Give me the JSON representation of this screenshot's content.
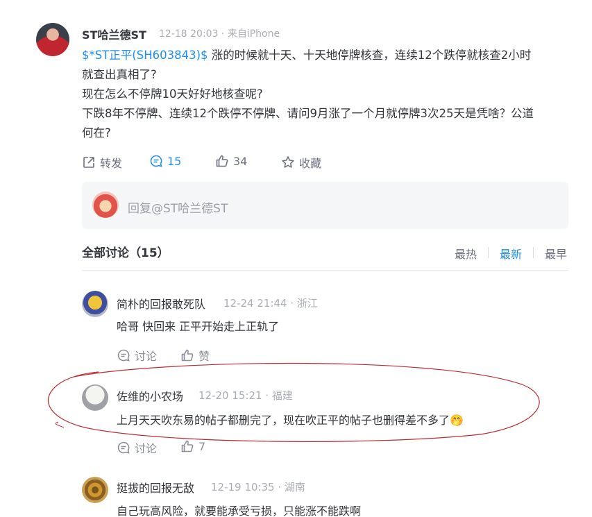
{
  "post": {
    "author": "ST哈兰德ST",
    "meta": "12-18 20:03 · 来自iPhone",
    "stock_link": "$*ST正平(SH603843)$",
    "line1_rest": " 涨的时候就十天、十天地停牌核查，连续12个跌停就核查2小时",
    "line2": "就查出真相了?",
    "line3": "现在怎么不停牌10天好好地核查呢?",
    "line4": "下跌8年不停牌、连续12个跌停不停牌、请问9月涨了一个月就停牌3次25天是凭啥？公道",
    "line5": "何在?",
    "actions": {
      "repost_label": "转发",
      "comment_count": "15",
      "like_count": "34",
      "favorite_label": "收藏"
    }
  },
  "reply_box": {
    "placeholder": "回复@ST哈兰德ST"
  },
  "discussion": {
    "title": "全部讨论（15）",
    "sort_options": [
      "最热",
      "最新",
      "最早"
    ],
    "active_sort": "最新"
  },
  "comments": [
    {
      "author": "简朴的回报敢死队",
      "meta": "12-24 21:44 · 浙江",
      "text": "哈哥 快回来 正平开始走上正轨了",
      "discuss_label": "讨论",
      "like_label": "赞"
    },
    {
      "author": "佐维的小农场",
      "meta": "12-20 15:21 · 福建",
      "text": "上月天天吹东易的帖子都删完了，现在吹正平的帖子也删得差不多了",
      "emoji": "🤭",
      "discuss_label": "讨论",
      "like_label": "7"
    },
    {
      "author": "挺拔的回报无敌",
      "meta": "12-19 10:35 · 湖南",
      "text": "自己玩高风险，就要能承受亏损，只能涨不能跌啊"
    }
  ],
  "colors": {
    "link": "#1e8ef0",
    "text": "#33353c",
    "muted": "#aaadb5",
    "annotation": "#c0292e"
  }
}
